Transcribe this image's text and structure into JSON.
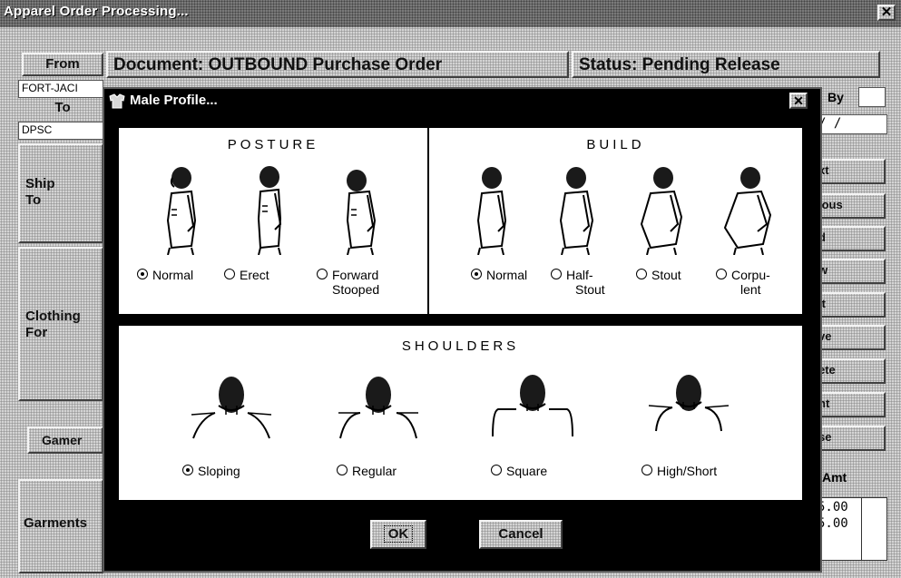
{
  "window": {
    "title": "Apparel Order Processing..."
  },
  "header": {
    "from_label": "From",
    "document": "Document: OUTBOUND  Purchase Order",
    "status": "Status: Pending Release"
  },
  "left": {
    "from_value": "FORT-JACI",
    "to_label": "To",
    "to_value": "DPSC",
    "ship_to_label": "Ship\nTo",
    "clothing_for_label": "Clothing\nFor",
    "garment_button": "Gamer",
    "garments_label": "Garments"
  },
  "right": {
    "by_label": "By",
    "date_value": "/ /",
    "buttons": [
      "xt",
      "ious",
      "d",
      "w",
      "it",
      "ve",
      "ete",
      "nt",
      "se"
    ],
    "amt_label": "Amt",
    "amounts": [
      "5.00",
      "5.00"
    ]
  },
  "modal": {
    "title": "Male Profile...",
    "posture": {
      "heading": "POSTURE",
      "options": [
        {
          "label": "Normal",
          "selected": true
        },
        {
          "label": "Erect",
          "selected": false
        },
        {
          "label": "Forward",
          "label2": "Stooped",
          "selected": false
        }
      ]
    },
    "build": {
      "heading": "BUILD",
      "options": [
        {
          "label": "Normal",
          "selected": true
        },
        {
          "label": "Half-",
          "label2": "Stout",
          "selected": false
        },
        {
          "label": "Stout",
          "selected": false
        },
        {
          "label": "Corpu-",
          "label2": "lent",
          "selected": false
        }
      ]
    },
    "shoulders": {
      "heading": "SHOULDERS",
      "options": [
        {
          "label": "Sloping",
          "selected": true
        },
        {
          "label": "Regular",
          "selected": false
        },
        {
          "label": "Square",
          "selected": false
        },
        {
          "label": "High/Short",
          "selected": false
        }
      ]
    },
    "ok_label": "OK",
    "cancel_label": "Cancel"
  },
  "icons": [
    "close-icon",
    "shirt-icon",
    "radio-icon"
  ],
  "colors": {
    "titlebar": "#000000",
    "panel": "#ffffff",
    "face": "#c4c4c4"
  }
}
